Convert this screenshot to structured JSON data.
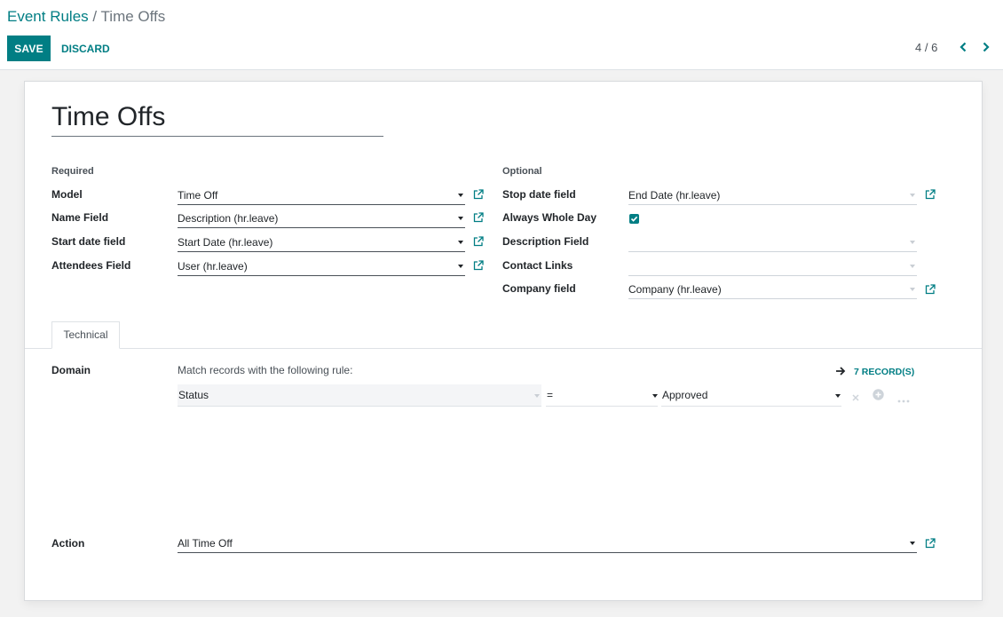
{
  "breadcrumb": {
    "parent": "Event Rules",
    "separator": " / ",
    "current": "Time Offs"
  },
  "toolbar": {
    "save_label": "SAVE",
    "discard_label": "DISCARD"
  },
  "pager": {
    "value": "4 / 6"
  },
  "record": {
    "title": "Time Offs"
  },
  "required": {
    "title": "Required",
    "fields": [
      {
        "label": "Model",
        "value": "Time Off"
      },
      {
        "label": "Name Field",
        "value": "Description (hr.leave)"
      },
      {
        "label": "Start date field",
        "value": "Start Date (hr.leave)"
      },
      {
        "label": "Attendees Field",
        "value": "User (hr.leave)"
      }
    ]
  },
  "optional": {
    "title": "Optional",
    "stop_date": {
      "label": "Stop date field",
      "value": "End Date (hr.leave)"
    },
    "whole_day": {
      "label": "Always Whole Day",
      "checked": true
    },
    "description": {
      "label": "Description Field",
      "value": ""
    },
    "contact": {
      "label": "Contact Links",
      "value": ""
    },
    "company": {
      "label": "Company field",
      "value": "Company (hr.leave)"
    }
  },
  "tabs": [
    {
      "label": "Technical",
      "active": true
    }
  ],
  "domain": {
    "label": "Domain",
    "description": "Match records with the following rule:",
    "records_label": "7 RECORD(S)",
    "rule": {
      "path": "Status",
      "operator": "=",
      "value": "Approved"
    }
  },
  "action": {
    "label": "Action",
    "value": "All Time Off"
  },
  "colors": {
    "primary": "#017e84",
    "text": "#212529",
    "muted": "#6c757d"
  }
}
